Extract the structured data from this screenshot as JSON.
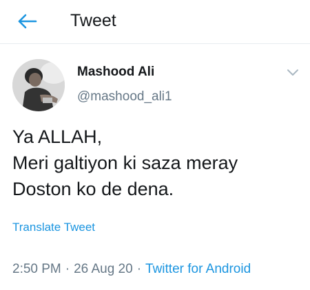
{
  "header": {
    "back_icon": "arrow-left-icon",
    "title": "Tweet",
    "accent_color": "#1b95e0"
  },
  "author": {
    "display_name": "Mashood Ali",
    "handle": "@mashood_ali1",
    "avatar_icon": "profile-photo",
    "menu_icon": "chevron-down-icon"
  },
  "tweet": {
    "lines": [
      "Ya ALLAH,",
      "Meri galtiyon ki saza meray",
      "Doston ko de dena."
    ],
    "translate_label": "Translate Tweet"
  },
  "meta": {
    "time": "2:50 PM",
    "separator": "·",
    "date": "26 Aug 20",
    "source": "Twitter for Android"
  }
}
